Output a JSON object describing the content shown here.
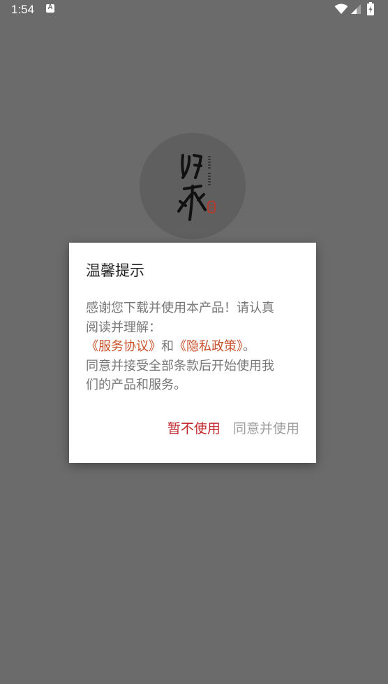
{
  "status_bar": {
    "time": "1:54",
    "notification_icon_letter": "A",
    "icons": [
      "wifi-icon",
      "signal-icon",
      "battery-icon"
    ]
  },
  "logo": {
    "icon": "app-logo-calligraphy"
  },
  "dialog": {
    "title": "温馨提示",
    "body_line1": "感谢您下载并使用本产品！请认真",
    "body_line2": "阅读并理解：",
    "link_service": "《服务协议》",
    "conjunction": "和",
    "link_privacy": "《隐私政策》",
    "period": "。",
    "body_line4": "同意并接受全部条款后开始使用我",
    "body_line5": "们的产品和服务。",
    "decline_label": "暂不使用",
    "accept_label": "同意并使用"
  },
  "colors": {
    "backdrop": "#6b6b6b",
    "link": "#c8502a",
    "decline": "#c0282d",
    "accept": "#9e9e9e"
  }
}
